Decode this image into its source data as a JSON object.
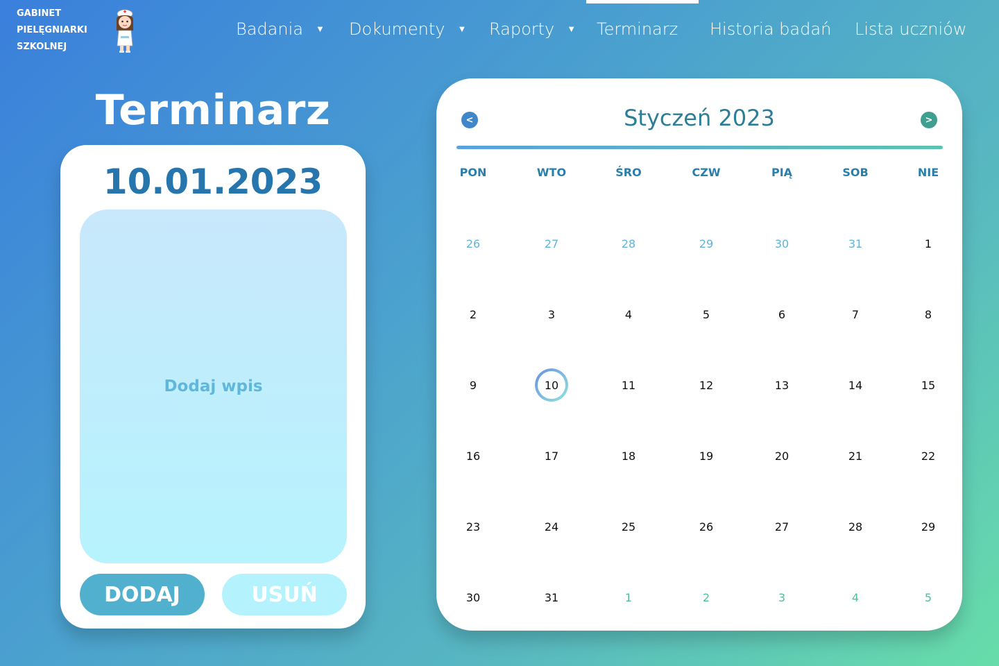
{
  "brand": {
    "lines": [
      "GABINET",
      "PIELĘGNIARKI",
      "SZKOLNEJ"
    ],
    "logo_icon": "nurse-icon"
  },
  "nav": {
    "items": [
      {
        "label": "Badania",
        "dropdown": true
      },
      {
        "label": "Dokumenty",
        "dropdown": true
      },
      {
        "label": "Raporty",
        "dropdown": true
      },
      {
        "label": "Terminarz",
        "dropdown": false,
        "active": true
      },
      {
        "label": "Historia badań",
        "dropdown": false
      },
      {
        "label": "Lista uczniów",
        "dropdown": false
      }
    ],
    "caret_glyph": "▼"
  },
  "agenda": {
    "title": "Terminarz",
    "date": "10.01.2023",
    "entry_placeholder": "Dodaj wpis",
    "add_label": "DODAJ",
    "delete_label": "USUŃ"
  },
  "calendar": {
    "month_label": "Styczeń 2023",
    "prev_icon": "chevron-left-icon",
    "next_icon": "chevron-right-icon",
    "prev_glyph": "<",
    "next_glyph": ">",
    "weekdays": [
      "PON",
      "WTO",
      "ŚRO",
      "CZW",
      "PIĄ",
      "SOB",
      "NIE"
    ],
    "selected_day": "10",
    "weeks": [
      [
        {
          "d": "26",
          "m": "prev"
        },
        {
          "d": "27",
          "m": "prev"
        },
        {
          "d": "28",
          "m": "prev"
        },
        {
          "d": "29",
          "m": "prev"
        },
        {
          "d": "30",
          "m": "prev"
        },
        {
          "d": "31",
          "m": "prev"
        },
        {
          "d": "1",
          "m": "cur"
        }
      ],
      [
        {
          "d": "2",
          "m": "cur"
        },
        {
          "d": "3",
          "m": "cur"
        },
        {
          "d": "4",
          "m": "cur"
        },
        {
          "d": "5",
          "m": "cur"
        },
        {
          "d": "6",
          "m": "cur"
        },
        {
          "d": "7",
          "m": "cur"
        },
        {
          "d": "8",
          "m": "cur"
        }
      ],
      [
        {
          "d": "9",
          "m": "cur"
        },
        {
          "d": "10",
          "m": "cur"
        },
        {
          "d": "11",
          "m": "cur"
        },
        {
          "d": "12",
          "m": "cur"
        },
        {
          "d": "13",
          "m": "cur"
        },
        {
          "d": "14",
          "m": "cur"
        },
        {
          "d": "15",
          "m": "cur"
        }
      ],
      [
        {
          "d": "16",
          "m": "cur"
        },
        {
          "d": "17",
          "m": "cur"
        },
        {
          "d": "18",
          "m": "cur"
        },
        {
          "d": "19",
          "m": "cur"
        },
        {
          "d": "20",
          "m": "cur"
        },
        {
          "d": "21",
          "m": "cur"
        },
        {
          "d": "22",
          "m": "cur"
        }
      ],
      [
        {
          "d": "23",
          "m": "cur"
        },
        {
          "d": "24",
          "m": "cur"
        },
        {
          "d": "25",
          "m": "cur"
        },
        {
          "d": "26",
          "m": "cur"
        },
        {
          "d": "27",
          "m": "cur"
        },
        {
          "d": "28",
          "m": "cur"
        },
        {
          "d": "29",
          "m": "cur"
        }
      ],
      [
        {
          "d": "30",
          "m": "cur"
        },
        {
          "d": "31",
          "m": "cur"
        },
        {
          "d": "1",
          "m": "next"
        },
        {
          "d": "2",
          "m": "next"
        },
        {
          "d": "3",
          "m": "next"
        },
        {
          "d": "4",
          "m": "next"
        },
        {
          "d": "5",
          "m": "next"
        }
      ]
    ]
  },
  "colors": {
    "accent_dark": "#2675ad",
    "title_teal": "#2c7d98",
    "button_add": "#52b0cf",
    "button_delete": "#b4f3fd"
  }
}
